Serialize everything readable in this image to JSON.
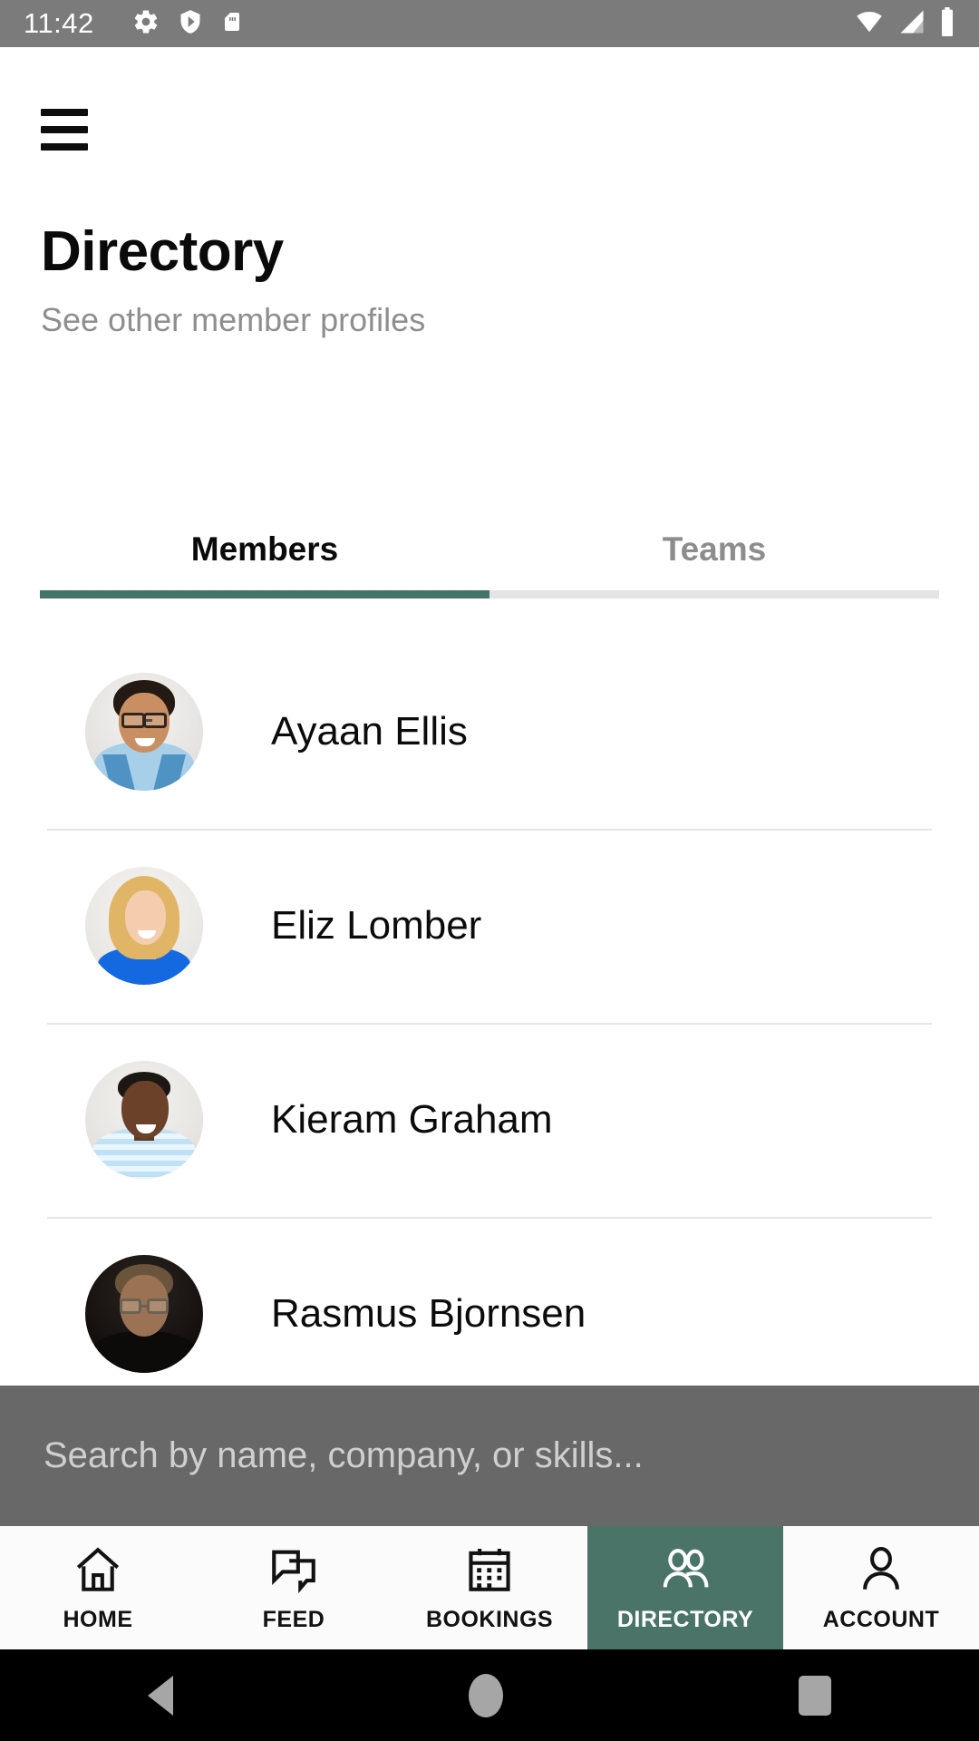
{
  "status_bar": {
    "time": "11:42",
    "left_icons": [
      "gear-icon",
      "shield-play-icon",
      "sd-card-icon"
    ],
    "right_icons": [
      "wifi-icon",
      "cellular-signal-icon",
      "battery-icon"
    ],
    "background_color": "#7b7b7b"
  },
  "app_bar": {
    "menu_icon": "hamburger-menu-icon"
  },
  "header": {
    "title": "Directory",
    "subtitle": "See other member profiles"
  },
  "tabs": {
    "items": [
      {
        "label": "Members",
        "active": true
      },
      {
        "label": "Teams",
        "active": false
      }
    ],
    "active_underline_color": "#44736a",
    "inactive_underline_color": "#e4e4e4"
  },
  "members": [
    {
      "name": "Ayaan Ellis",
      "avatar": "avatar-ayaan-ellis"
    },
    {
      "name": "Eliz Lomber",
      "avatar": "avatar-eliz-lomber"
    },
    {
      "name": "Kieram Graham",
      "avatar": "avatar-kieram-graham"
    },
    {
      "name": "Rasmus Bjornsen",
      "avatar": "avatar-rasmus-bjornsen"
    }
  ],
  "search": {
    "placeholder": "Search by name, company, or skills...",
    "value": "",
    "overlay_color": "rgba(40,40,40,0.70)"
  },
  "bottom_nav": {
    "items": [
      {
        "label": "HOME",
        "icon": "home-icon",
        "active": false
      },
      {
        "label": "FEED",
        "icon": "chat-bubbles-icon",
        "active": false
      },
      {
        "label": "BOOKINGS",
        "icon": "calendar-icon",
        "active": false
      },
      {
        "label": "DIRECTORY",
        "icon": "people-icon",
        "active": true
      },
      {
        "label": "ACCOUNT",
        "icon": "person-icon",
        "active": false
      }
    ],
    "active_color": "#4a7468"
  },
  "system_nav": {
    "back": "back-triangle-icon",
    "home": "home-circle-icon",
    "recents": "recents-square-icon"
  }
}
